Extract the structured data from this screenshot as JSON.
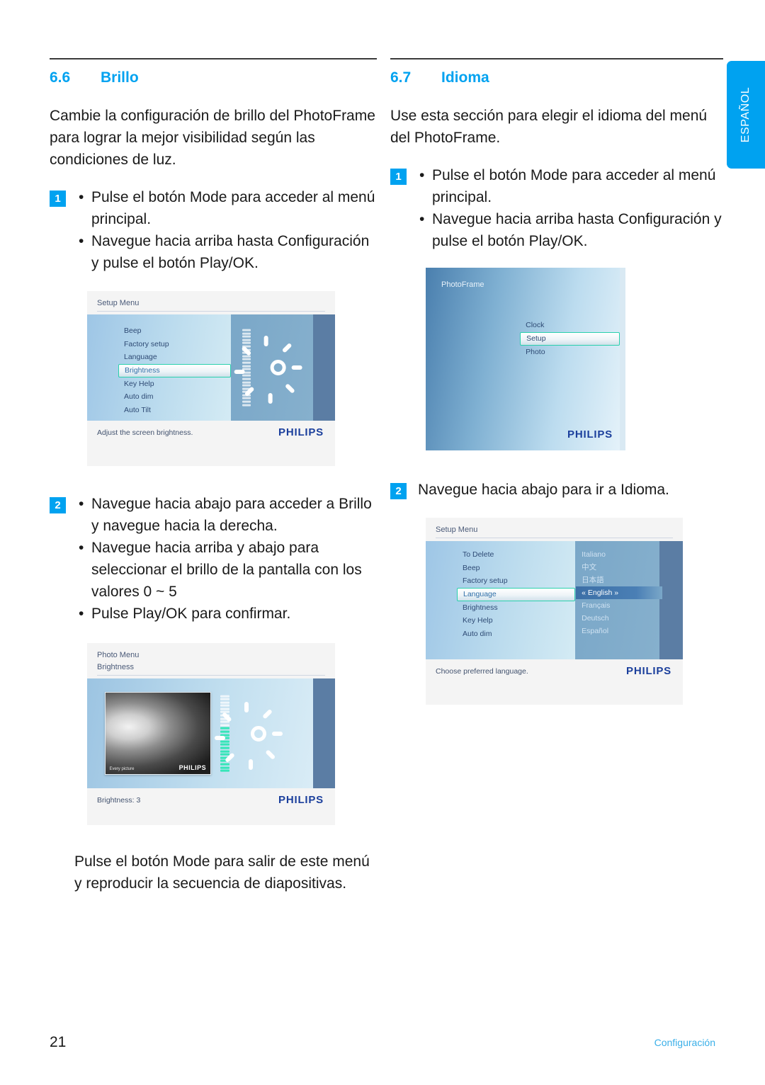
{
  "language_tab": {
    "label": "ESPAÑOL"
  },
  "footer": {
    "page_number": "21",
    "section_label": "Configuración"
  },
  "left_column": {
    "heading": {
      "number": "6.6",
      "title": "Brillo"
    },
    "intro": "Cambie la configuración de brillo del PhotoFrame para lograr la mejor visibilidad según las condiciones de luz.",
    "step1": {
      "badge": "1",
      "bullets": [
        "Pulse el botón Mode para acceder al menú principal.",
        "Navegue hacia arriba hasta Configuración y pulse el botón Play/OK."
      ]
    },
    "step2": {
      "badge": "2",
      "bullets": [
        "Navegue hacia abajo para acceder a Brillo y navegue hacia la derecha.",
        "Navegue hacia arriba y abajo para seleccionar el brillo de la pantalla con los valores 0 ~ 5",
        "Pulse Play/OK para confirmar."
      ]
    },
    "closing": "Pulse el botón Mode para salir de este menú y reproducir la secuencia de diapositivas.",
    "screenshot_setup": {
      "header_title": "Setup Menu",
      "menu_items": [
        "Beep",
        "Factory setup",
        "Language",
        "Brightness",
        "Key Help",
        "Auto dim",
        "Auto Tilt"
      ],
      "selected_item": "Brightness",
      "status_text": "Adjust the screen brightness.",
      "brand": "PHILIPS"
    },
    "screenshot_brightness": {
      "header_title": "Photo Menu",
      "header_subtitle": "Brightness",
      "status_text": "Brightness: 3",
      "brand": "PHILIPS",
      "photo_caption": "Every picture",
      "photo_brand": "PHILIPS"
    }
  },
  "right_column": {
    "heading": {
      "number": "6.7",
      "title": "Idioma"
    },
    "intro": "Use esta sección para elegir el idioma del menú del PhotoFrame.",
    "step1": {
      "badge": "1",
      "bullets": [
        "Pulse el botón Mode para acceder al menú principal.",
        "Navegue hacia arriba hasta Configuración y pulse el botón Play/OK."
      ]
    },
    "step2": {
      "badge": "2",
      "text": "Navegue hacia abajo para ir a Idioma."
    },
    "screenshot_mainmenu": {
      "header_title": "PhotoFrame",
      "menu_items": [
        "Clock",
        "Setup",
        "Photo"
      ],
      "selected_item": "Setup",
      "brand": "PHILIPS"
    },
    "screenshot_language": {
      "header_title": "Setup Menu",
      "menu_items": [
        "To Delete",
        "Beep",
        "Factory setup",
        "Language",
        "Brightness",
        "Key Help",
        "Auto dim"
      ],
      "selected_item": "Language",
      "language_options": [
        "Italiano",
        "中文",
        "日本語",
        "« English »",
        "Français",
        "Deutsch",
        "Español"
      ],
      "current_language": "« English »",
      "status_text": "Choose preferred language.",
      "brand": "PHILIPS"
    }
  },
  "colors": {
    "accent": "#00A2F0",
    "brand_blue": "#1B3F9C",
    "highlight_green": "#2AD0AD"
  }
}
